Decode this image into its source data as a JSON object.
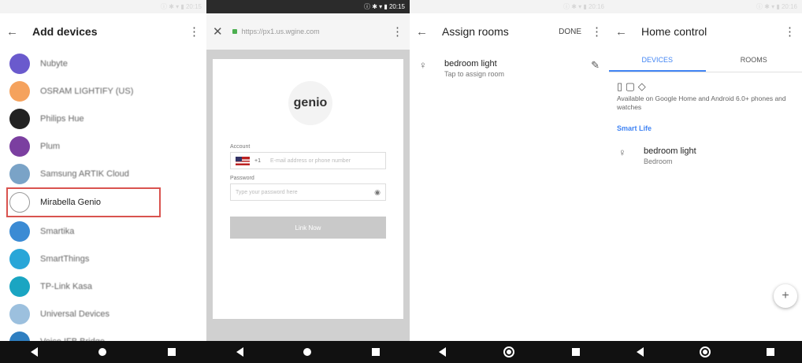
{
  "panel1": {
    "status": "ⓘ ✱ ▾ ▮ 20:15",
    "title": "Add devices",
    "back_icon": "arrow-left-icon",
    "devices": [
      {
        "name": "Nubyte",
        "color": "#6a5acd"
      },
      {
        "name": "OSRAM LIGHTIFY (US)",
        "color": "#f5a25d"
      },
      {
        "name": "Philips Hue",
        "color": "#222222"
      },
      {
        "name": "Plum",
        "color": "#7b3fa0"
      },
      {
        "name": "Samsung ARTIK Cloud",
        "color": "#7aa3c7"
      },
      {
        "name": "Mirabella Genio",
        "color": "#ffffff"
      },
      {
        "name": "Smartika",
        "color": "#3b8bd4"
      },
      {
        "name": "SmartThings",
        "color": "#29a6d8"
      },
      {
        "name": "TP-Link Kasa",
        "color": "#1aa5c2"
      },
      {
        "name": "Universal Devices",
        "color": "#9cc0de"
      },
      {
        "name": "Voice IFB Bridge",
        "color": "#2f7fc1"
      }
    ],
    "selected_index": 5
  },
  "panel2": {
    "status": "ⓘ ✱ ▾ ▮ 20:15",
    "url": "https://px1.us.wgine.com",
    "logo_text": "genio",
    "account_label": "Account",
    "country_code": "+1",
    "account_placeholder": "E-mail address or phone number",
    "password_label": "Password",
    "password_placeholder": "Type your password here",
    "link_button": "Link Now"
  },
  "panel3": {
    "status": "ⓘ ✱ ▾ ▮ 20:16",
    "title": "Assign rooms",
    "done": "DONE",
    "device_title": "bedroom light",
    "device_sub": "Tap to assign room"
  },
  "panel4": {
    "status": "ⓘ ✱ ▾ ▮ 20:16",
    "title": "Home control",
    "tab_devices": "DEVICES",
    "tab_rooms": "ROOMS",
    "availability": "Available on Google Home and Android 6.0+ phones and watches",
    "section": "Smart Life",
    "device_title": "bedroom light",
    "device_sub": "Bedroom",
    "fab": "+"
  },
  "colors": {
    "accent": "#4285f4",
    "highlight_border": "#d9534f"
  }
}
